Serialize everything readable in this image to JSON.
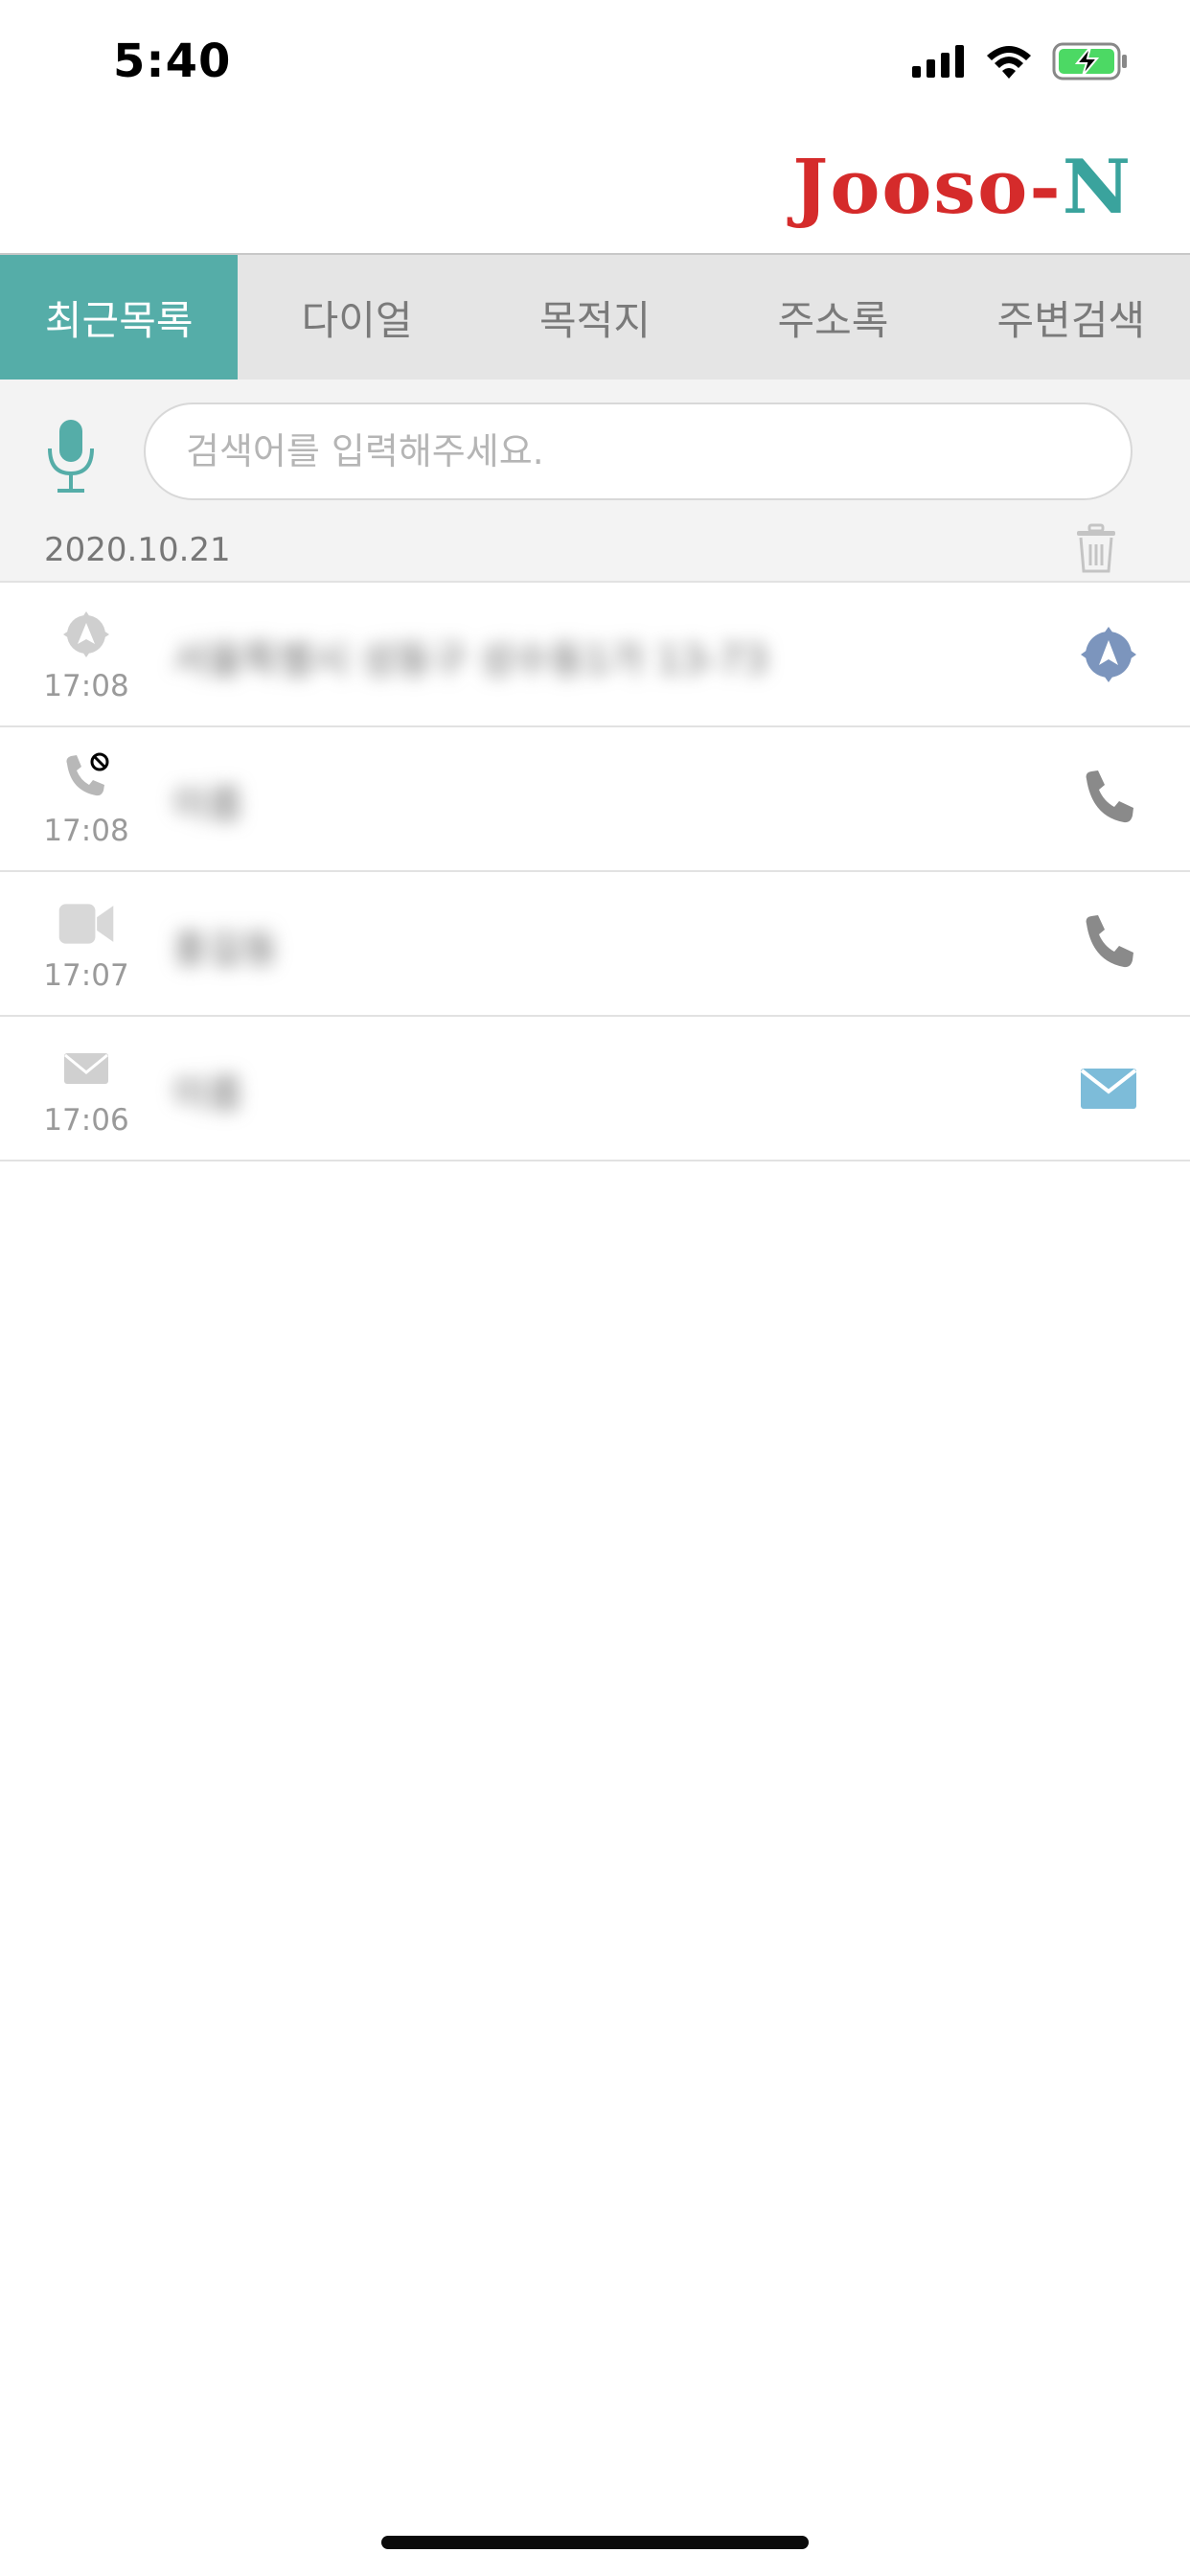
{
  "status": {
    "time": "5:40"
  },
  "logo": {
    "part1": "Jooso-",
    "part2": "N"
  },
  "tabs": [
    {
      "label": "최근목록",
      "active": true
    },
    {
      "label": "다이얼",
      "active": false
    },
    {
      "label": "목적지",
      "active": false
    },
    {
      "label": "주소록",
      "active": false
    },
    {
      "label": "주변검색",
      "active": false
    }
  ],
  "search": {
    "placeholder": "검색어를 입력해주세요.",
    "value": ""
  },
  "date_header": "2020.10.21",
  "rows": [
    {
      "type": "navigation",
      "time": "17:08",
      "text": "서울특별시 성동구 성수동1가 13-73",
      "action": "navigate-icon"
    },
    {
      "type": "missed-call",
      "time": "17:08",
      "text": "이름",
      "action": "phone-icon"
    },
    {
      "type": "video-call",
      "time": "17:07",
      "text": "홍길동",
      "action": "phone-icon"
    },
    {
      "type": "message",
      "time": "17:06",
      "text": "이름",
      "action": "mail-icon"
    }
  ],
  "colors": {
    "accent": "#55ada8",
    "logo_red": "#d52b2b",
    "logo_teal": "#3aa39d",
    "nav_blue": "#7c95bd",
    "mail_blue": "#7dbcd9"
  }
}
